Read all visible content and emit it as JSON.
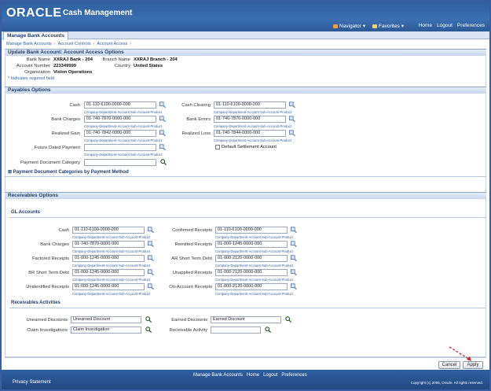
{
  "header": {
    "logo": "ORACLE",
    "app_title": "Cash Management",
    "navigator": "Navigator",
    "favorites": "Favorites",
    "home": "Home",
    "logout": "Logout",
    "preferences": "Preferences"
  },
  "tab": {
    "label": "Manage Bank Accounts"
  },
  "breadcrumbs": [
    "Manage Bank Accounts",
    "Account Controls",
    "Account Access"
  ],
  "page": {
    "title": "Update Bank Account: Account Access Options",
    "bank_name_label": "Bank Name",
    "bank_name": "XXRAJ Bank - 204",
    "branch_name_label": "Branch Name",
    "branch_name": "XXRAJ Branch - 204",
    "account_number_label": "Account Number",
    "account_number": "223349999",
    "country_label": "Country",
    "country": "United States",
    "organization_label": "Organization",
    "organization": "Vision Operations",
    "required_note": "* Indicates required field"
  },
  "hint": "Company-Department-Account-Sub-Account-Product",
  "payables": {
    "title": "Payables Options",
    "cash_label": "Cash",
    "cash": "01-110-6100-0000-000",
    "cash_clearing_label": "Cash Clearing",
    "cash_clearing": "01-110-6100-0000-000",
    "bank_charges_label": "Bank Charges",
    "bank_charges": "01-740-7870-0000-000",
    "bank_errors_label": "Bank Errors",
    "bank_errors": "01-740-7870-0000-000",
    "realized_gain_label": "Realized Gain",
    "realized_gain": "01-740-7842-0000-000",
    "realized_loss_label": "Realized Loss",
    "realized_loss": "01-740-7844-0000-000",
    "future_dated_label": "Future Dated Payment",
    "default_settlement_label": "Default Settlement Account",
    "payment_doc_cat_label": "Payment Document Category",
    "payment_doc_cats_toggle": "Payment Document Categories by Payment Method"
  },
  "receivables": {
    "title": "Receivables Options",
    "gl_accounts_title": "GL Accounts",
    "cash_label": "Cash",
    "cash": "01-110-6100-0000-000",
    "confirmed_label": "Confirmed Receipts",
    "confirmed": "01-110-6100-0000-000",
    "bank_charges_label": "Bank Charges",
    "bank_charges": "01-740-7870-0000-000",
    "remitted_label": "Remitted Receipts",
    "remitted": "01-000-1245-0000-000",
    "factored_label": "Factored Receipts",
    "factored": "01-000-1245-0000-000",
    "ar_short_label": "AR Short Term Debt",
    "ar_short": "01-000-2120-0000-000",
    "br_short_label": "BR Short Term Debt",
    "br_short": "01-000-1245-0000-000",
    "unapplied_label": "Unapplied Receipts",
    "unapplied": "01-000-2120-0000-000",
    "unidentified_label": "Unidentified Receipts",
    "unidentified": "01-000-1245-0000-000",
    "on_account_label": "On-Account Receipts",
    "on_account": "01-000-2120-0000-000",
    "activities_title": "Receivables Activities",
    "unearned_label": "Unearned Discounts",
    "unearned": "Unearned Discount",
    "earned_label": "Earned Discounts",
    "earned": "Earned Discount",
    "claim_label": "Claim Investigations",
    "claim": "Claim Investigation",
    "rec_activity_label": "Receivable Activity"
  },
  "buttons": {
    "cancel": "Cancel",
    "apply": "Apply"
  },
  "footer": {
    "links": [
      "Manage Bank Accounts",
      "Home",
      "Logout",
      "Preferences"
    ],
    "privacy": "Privacy Statement",
    "copyright": "Copyright (c) 2006, Oracle. All rights reserved."
  },
  "colors": {
    "header": "#2f5f9e",
    "section": "#c9d7ec",
    "accent": "#3060a0"
  }
}
